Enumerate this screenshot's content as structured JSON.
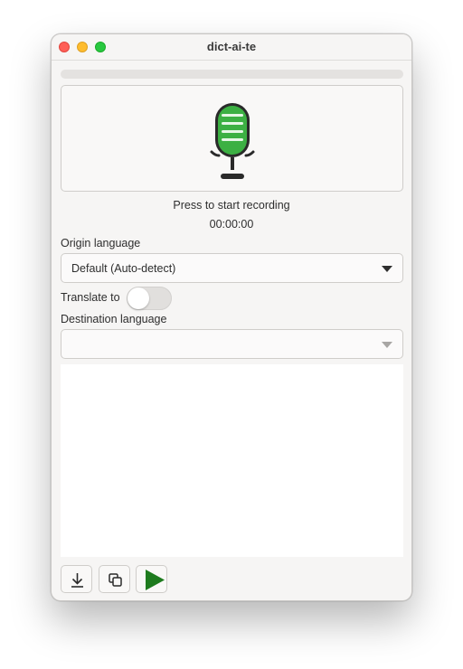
{
  "window": {
    "title": "dict-ai-te"
  },
  "traffic_lights": [
    "close",
    "minimize",
    "zoom"
  ],
  "progress": {
    "value": 0
  },
  "recorder": {
    "icon": "microphone-icon",
    "status_text": "Press to start recording",
    "elapsed": "00:00:00"
  },
  "origin_language": {
    "label": "Origin language",
    "selected": "Default (Auto-detect)"
  },
  "translate": {
    "label": "Translate to",
    "enabled": false
  },
  "destination_language": {
    "label": "Destination language",
    "selected": "",
    "disabled": true
  },
  "transcript": {
    "text": ""
  },
  "toolbar": {
    "buttons": [
      {
        "name": "save-button",
        "icon": "download-icon"
      },
      {
        "name": "copy-button",
        "icon": "copy-icon"
      },
      {
        "name": "play-button",
        "icon": "play-icon"
      }
    ]
  },
  "colors": {
    "mic_green": "#3cb043",
    "play_green": "#1e7b1e",
    "window_bg": "#f6f5f4"
  }
}
